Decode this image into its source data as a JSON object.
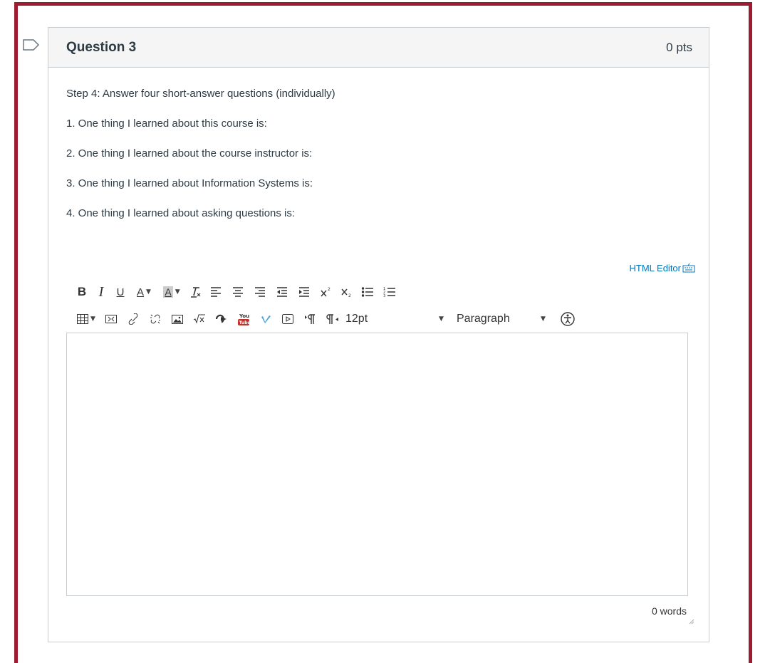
{
  "question": {
    "title": "Question 3",
    "points": "0 pts",
    "lines": [
      "Step 4: Answer four short-answer questions (individually)",
      "1. One thing I learned about this course is:",
      "2. One thing I learned about the course instructor is:",
      "3. One thing I learned about Information Systems is:",
      "4. One thing I learned about asking questions is:"
    ]
  },
  "editor": {
    "html_editor_link": "HTML Editor",
    "font_size": "12pt",
    "block_format": "Paragraph",
    "word_count": "0 words",
    "content": ""
  },
  "colors": {
    "frame": "#9e1b32",
    "link": "#0076b8",
    "header_bg": "#f5f5f5",
    "border": "#c7cdd1"
  }
}
